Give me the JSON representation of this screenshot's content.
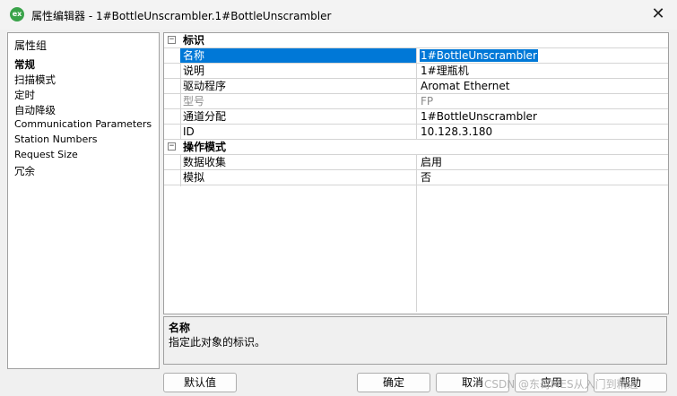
{
  "window": {
    "icon_text": "ex",
    "title": "属性编辑器 - 1#BottleUnscrambler.1#BottleUnscrambler",
    "close_symbol": "✕"
  },
  "left_panel": {
    "header": "属性组",
    "items": [
      {
        "label": "常规",
        "selected": true
      },
      {
        "label": "扫描模式"
      },
      {
        "label": "定时"
      },
      {
        "label": "自动降级"
      },
      {
        "label": "Communication Parameters"
      },
      {
        "label": "Station Numbers"
      },
      {
        "label": "Request Size"
      },
      {
        "label": "冗余"
      }
    ]
  },
  "grid": {
    "categories": [
      {
        "label": "标识",
        "toggle": "−",
        "rows": [
          {
            "name": "名称",
            "value": "1#BottleUnscrambler",
            "selected": true
          },
          {
            "name": "说明",
            "value": "1#理瓶机"
          },
          {
            "name": "驱动程序",
            "value": "Aromat Ethernet"
          },
          {
            "name": "型号",
            "value": "FP",
            "disabled": true
          },
          {
            "name": "通道分配",
            "value": "1#BottleUnscrambler"
          },
          {
            "name": "ID",
            "value": "10.128.3.180"
          }
        ]
      },
      {
        "label": "操作模式",
        "toggle": "−",
        "rows": [
          {
            "name": "数据收集",
            "value": "启用"
          },
          {
            "name": "模拟",
            "value": "否"
          }
        ]
      }
    ]
  },
  "description": {
    "title": "名称",
    "text": "指定此对象的标识。"
  },
  "buttons": {
    "defaults": "默认值",
    "ok": "确定",
    "cancel": "取消",
    "apply": "应用",
    "help": "帮助"
  },
  "watermark": "CSDN @东哥MES从入门到精通",
  "colors": {
    "selection": "#0078d7",
    "app_icon": "#3aa34a"
  }
}
